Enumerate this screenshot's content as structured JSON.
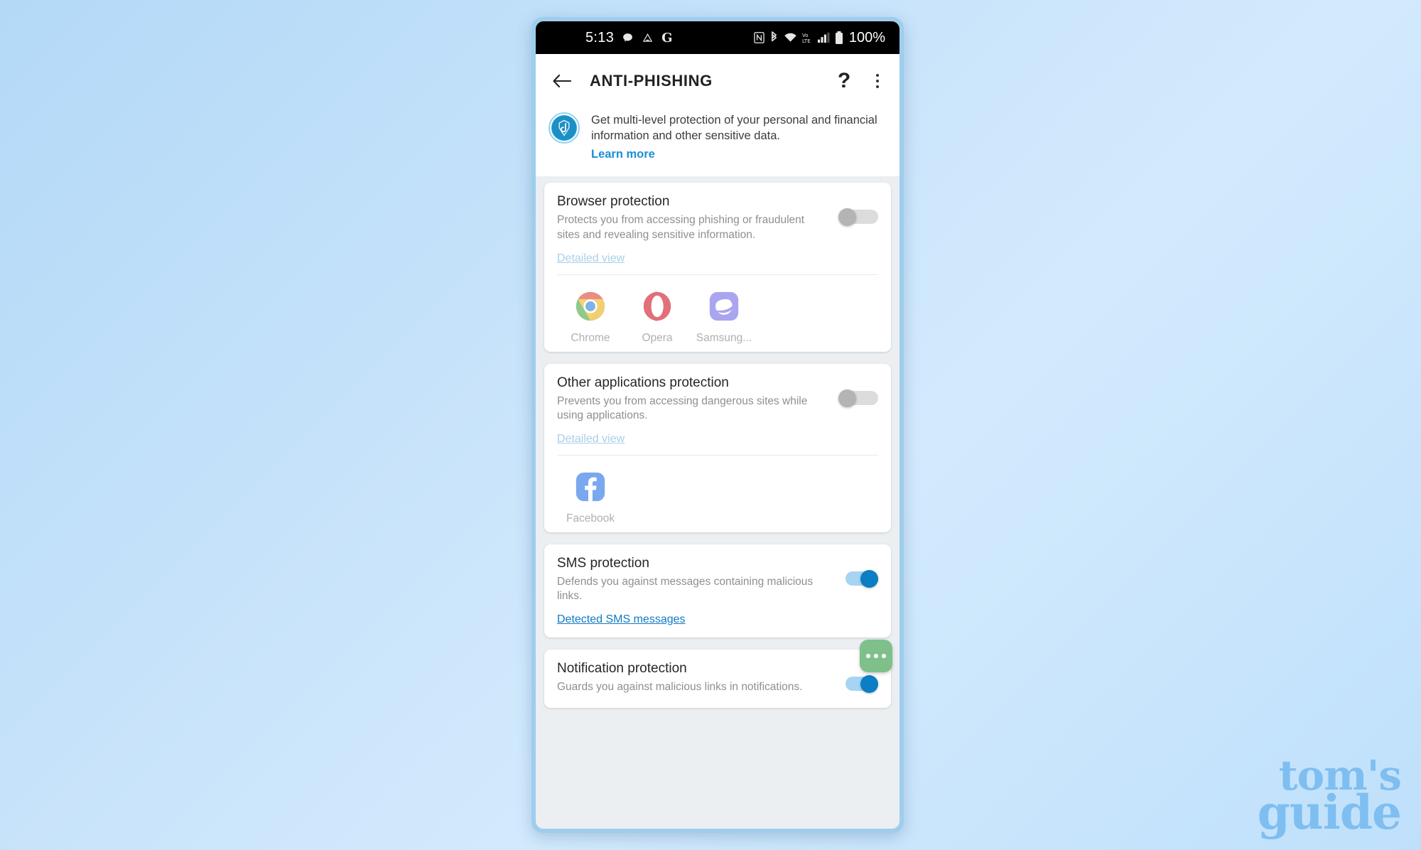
{
  "statusbar": {
    "clock": "5:13",
    "left_icons": [
      "chat-bubble-icon",
      "google-drive-icon",
      "google-g-icon"
    ],
    "right_icons": [
      "nfc-icon",
      "bluetooth-icon",
      "wifi-icon",
      "volte-icon",
      "signal-bars-icon",
      "battery-icon"
    ],
    "battery_percent": "100%"
  },
  "appbar": {
    "back_label": "←",
    "title": "ANTI-PHISHING",
    "help_label": "?",
    "overflow_name": "more-options"
  },
  "banner": {
    "icon": "bitdefender-shield-icon",
    "text": "Get multi-level protection of your personal and financial information and other sensitive data.",
    "link": "Learn more"
  },
  "colors": {
    "accent_blue": "#1079c4",
    "link_disabled": "#a8cfe9",
    "toggle_on_thumb": "#0b7ec4",
    "toggle_on_track": "#a6d4f2",
    "toggle_off_thumb": "#b4b4b4",
    "toggle_off_track": "#dcdcdc",
    "fab_green": "#7fc08a",
    "watermark_blue": "#7cbdf0"
  },
  "cards": [
    {
      "title": "Browser protection",
      "desc": "Protects you from accessing phishing or fraudulent sites and revealing sensitive information.",
      "link": "Detailed view",
      "link_state": "disabled",
      "toggle": "off",
      "apps": [
        {
          "name": "Chrome",
          "icon": "chrome-icon"
        },
        {
          "name": "Opera",
          "icon": "opera-icon"
        },
        {
          "name": "Samsung...",
          "icon": "samsung-internet-icon"
        }
      ]
    },
    {
      "title": "Other applications protection",
      "desc": "Prevents you from accessing dangerous sites while using applications.",
      "link": "Detailed view",
      "link_state": "disabled",
      "toggle": "off",
      "apps": [
        {
          "name": "Facebook",
          "icon": "facebook-icon"
        }
      ]
    },
    {
      "title": "SMS protection",
      "desc": "Defends you against messages containing malicious links.",
      "link": "Detected SMS messages",
      "link_state": "enabled",
      "toggle": "on",
      "apps": []
    },
    {
      "title": "Notification protection",
      "desc": "Guards you against malicious links in notifications.",
      "link": "",
      "link_state": "none",
      "toggle": "on",
      "apps": []
    }
  ],
  "fab": {
    "name": "more-actions-button",
    "icon": "three-dots-icon"
  },
  "watermark": {
    "line1": "tom's",
    "line2": "guide"
  }
}
